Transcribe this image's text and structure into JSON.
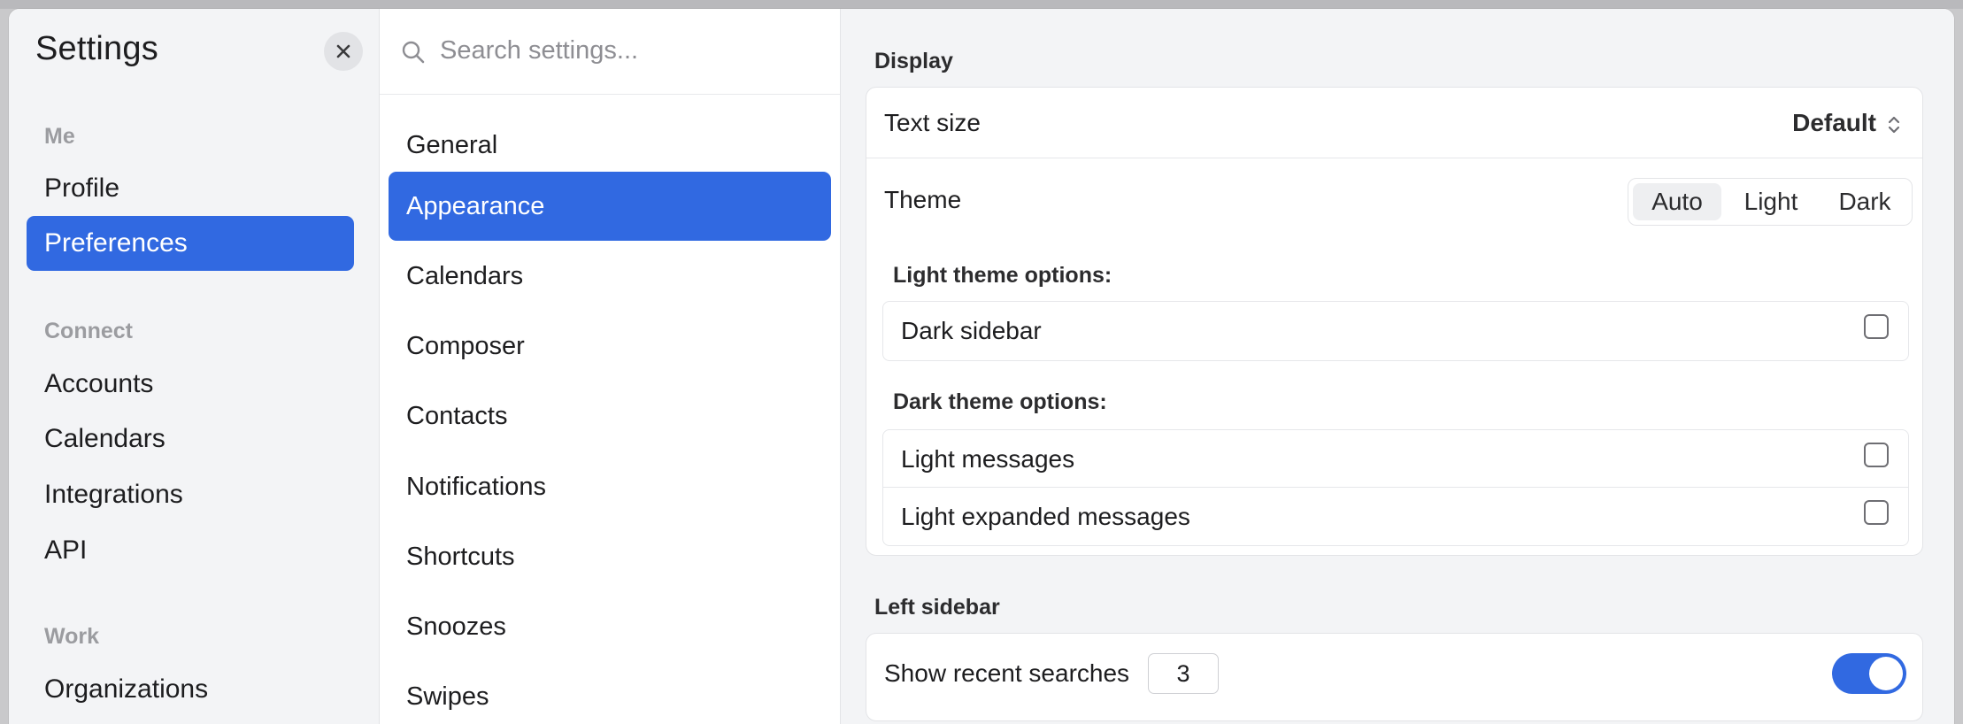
{
  "sidebar": {
    "title": "Settings",
    "sections": [
      {
        "label": "Me",
        "items": [
          {
            "label": "Profile",
            "active": false
          },
          {
            "label": "Preferences",
            "active": true
          }
        ]
      },
      {
        "label": "Connect",
        "items": [
          {
            "label": "Accounts",
            "active": false
          },
          {
            "label": "Calendars",
            "active": false
          },
          {
            "label": "Integrations",
            "active": false
          },
          {
            "label": "API",
            "active": false
          }
        ]
      },
      {
        "label": "Work",
        "items": [
          {
            "label": "Organizations",
            "active": false
          }
        ]
      }
    ]
  },
  "search": {
    "placeholder": "Search settings...",
    "value": ""
  },
  "categories": [
    {
      "label": "General",
      "active": false
    },
    {
      "label": "Appearance",
      "active": true
    },
    {
      "label": "Calendars",
      "active": false
    },
    {
      "label": "Composer",
      "active": false
    },
    {
      "label": "Contacts",
      "active": false
    },
    {
      "label": "Notifications",
      "active": false
    },
    {
      "label": "Shortcuts",
      "active": false
    },
    {
      "label": "Snoozes",
      "active": false
    },
    {
      "label": "Swipes",
      "active": false
    }
  ],
  "display": {
    "heading": "Display",
    "text_size": {
      "label": "Text size",
      "value": "Default"
    },
    "theme": {
      "label": "Theme",
      "options": [
        "Auto",
        "Light",
        "Dark"
      ],
      "selected": "Auto"
    },
    "light_options": {
      "heading": "Light theme options:",
      "items": [
        {
          "label": "Dark sidebar",
          "checked": false
        }
      ]
    },
    "dark_options": {
      "heading": "Dark theme options:",
      "items": [
        {
          "label": "Light messages",
          "checked": false
        },
        {
          "label": "Light expanded messages",
          "checked": false
        }
      ]
    }
  },
  "left_sidebar": {
    "heading": "Left sidebar",
    "recent_searches": {
      "label": "Show recent searches",
      "count": "3",
      "enabled": true
    }
  },
  "colors": {
    "accent": "#3169e1",
    "sidebar_bg": "#f3f4f6",
    "content_bg": "#f3f4f6"
  },
  "icons": {
    "close": "close-icon",
    "search": "search-icon",
    "text_size_chevrons": "chevron-up-down-icon"
  }
}
